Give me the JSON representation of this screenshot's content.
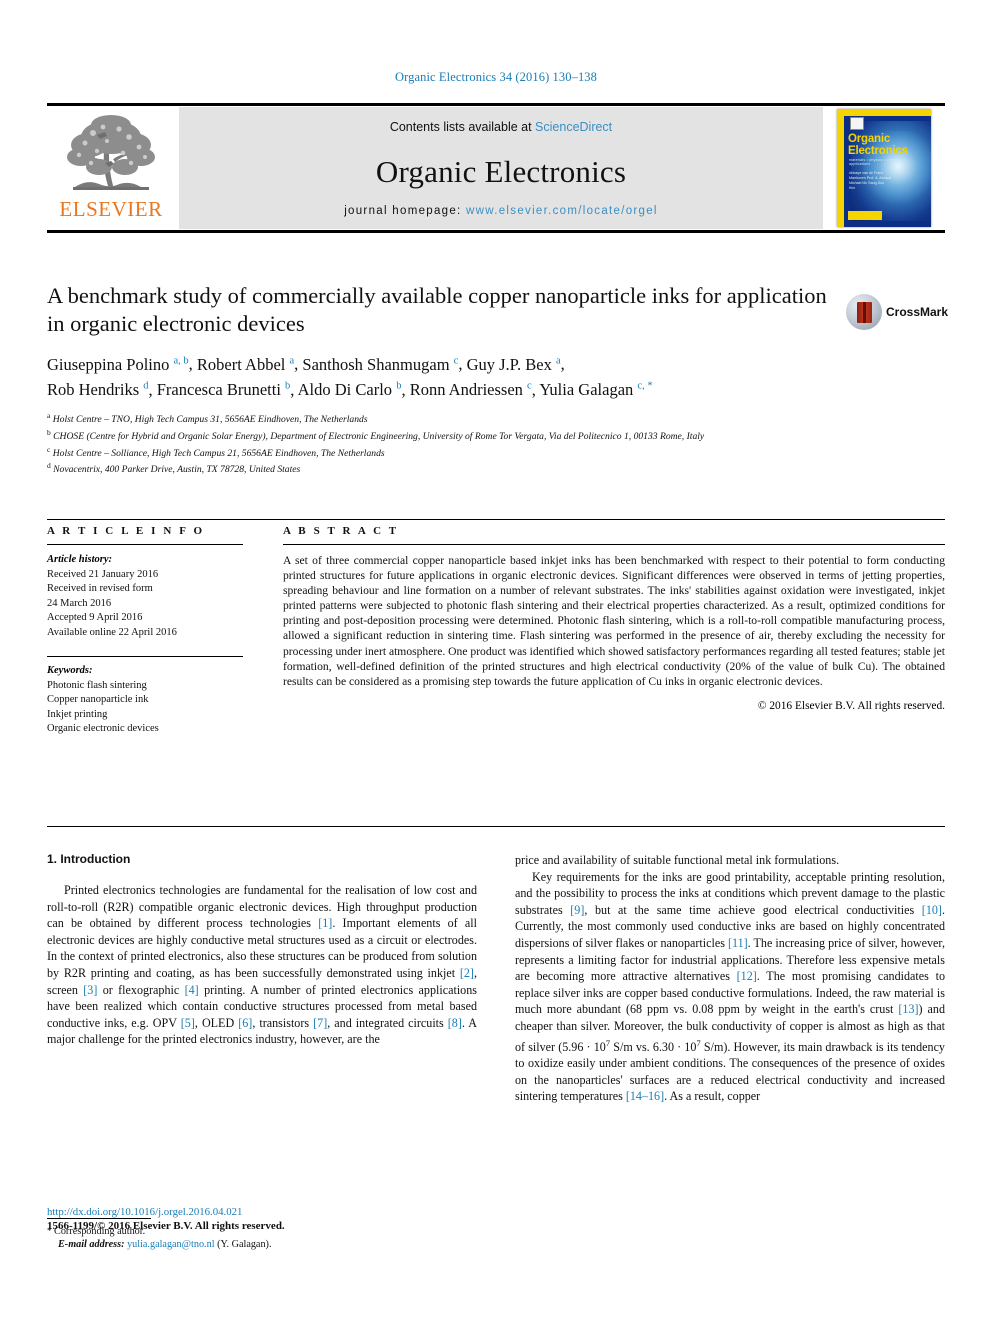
{
  "running_head": "Organic Electronics 34 (2016) 130–138",
  "masthead": {
    "publisher_logo_text": "ELSEVIER",
    "contents_prefix": "Contents lists available at ",
    "contents_link": "ScienceDirect",
    "journal_name": "Organic Electronics",
    "homepage_prefix": "journal homepage: ",
    "homepage_url": "www.elsevier.com/locate/orgel",
    "cover": {
      "title_line1": "Organic",
      "title_line2": "Electronics",
      "subtitle": "materials • physics • chemistry • applications",
      "editors_label": "Editors:",
      "editors": "Abbaye van de\nFrans Manhoven\nProf. A. Arnaud\nMichael Mc\nSang-Soo Kim",
      "publisher_mark": "ELSEVIER"
    }
  },
  "article": {
    "title": "A benchmark study of commercially available copper nanoparticle inks for application in organic electronic devices",
    "crossmark_label": "CrossMark",
    "authors_line1": "Giuseppina Polino",
    "authors": [
      {
        "name": "Giuseppina Polino",
        "sup": "a, b"
      },
      {
        "name": "Robert Abbel",
        "sup": "a"
      },
      {
        "name": "Santhosh Shanmugam",
        "sup": "c"
      },
      {
        "name": "Guy J.P. Bex",
        "sup": "a"
      },
      {
        "name": "Rob Hendriks",
        "sup": "d"
      },
      {
        "name": "Francesca Brunetti",
        "sup": "b"
      },
      {
        "name": "Aldo Di Carlo",
        "sup": "b"
      },
      {
        "name": "Ronn Andriessen",
        "sup": "c"
      },
      {
        "name": "Yulia Galagan",
        "sup": "c, *"
      }
    ],
    "affiliations": [
      {
        "mark": "a",
        "text": "Holst Centre – TNO, High Tech Campus 31, 5656AE Eindhoven, The Netherlands"
      },
      {
        "mark": "b",
        "text": "CHOSE (Centre for Hybrid and Organic Solar Energy), Department of Electronic Engineering, University of Rome Tor Vergata, Via del Politecnico 1, 00133 Rome, Italy"
      },
      {
        "mark": "c",
        "text": "Holst Centre – Solliance, High Tech Campus 21, 5656AE Eindhoven, The Netherlands"
      },
      {
        "mark": "d",
        "text": "Novacentrix, 400 Parker Drive, Austin, TX 78728, United States"
      }
    ]
  },
  "article_info": {
    "heading": "A R T I C L E  I N F O",
    "history_label": "Article history:",
    "history": [
      "Received 21 January 2016",
      "Received in revised form",
      "24 March 2016",
      "Accepted 9 April 2016",
      "Available online 22 April 2016"
    ],
    "keywords_label": "Keywords:",
    "keywords": [
      "Photonic flash sintering",
      "Copper nanoparticle ink",
      "Inkjet printing",
      "Organic electronic devices"
    ]
  },
  "abstract": {
    "heading": "A B S T R A C T",
    "text": "A set of three commercial copper nanoparticle based inkjet inks has been benchmarked with respect to their potential to form conducting printed structures for future applications in organic electronic devices. Significant differences were observed in terms of jetting properties, spreading behaviour and line formation on a number of relevant substrates. The inks' stabilities against oxidation were investigated, inkjet printed patterns were subjected to photonic flash sintering and their electrical properties characterized. As a result, optimized conditions for printing and post-deposition processing were determined. Photonic flash sintering, which is a roll-to-roll compatible manufacturing process, allowed a significant reduction in sintering time. Flash sintering was performed in the presence of air, thereby excluding the necessity for processing under inert atmosphere. One product was identified which showed satisfactory performances regarding all tested features; stable jet formation, well-defined definition of the printed structures and high electrical conductivity (20% of the value of bulk Cu). The obtained results can be considered as a promising step towards the future application of Cu inks in organic electronic devices.",
    "copyright": "© 2016 Elsevier B.V. All rights reserved."
  },
  "body": {
    "section_heading": "1. Introduction",
    "left_para_1": "Printed electronics technologies are fundamental for the realisation of low cost and roll-to-roll (R2R) compatible organic electronic devices. High throughput production can be obtained by different process technologies [1]. Important elements of all electronic devices are highly conductive metal structures used as a circuit or electrodes. In the context of printed electronics, also these structures can be produced from solution by R2R printing and coating, as has been successfully demonstrated using inkjet [2], screen [3] or flexographic [4] printing. A number of printed electronics applications have been realized which contain conductive structures processed from metal based conductive inks, e.g. OPV [5], OLED [6], transistors [7], and integrated circuits [8]. A major challenge for the printed electronics industry, however, are the",
    "right_para_1": "price and availability of suitable functional metal ink formulations.",
    "right_para_2": "Key requirements for the inks are good printability, acceptable printing resolution, and the possibility to process the inks at conditions which prevent damage to the plastic substrates [9], but at the same time achieve good electrical conductivities [10]. Currently, the most commonly used conductive inks are based on highly concentrated dispersions of silver flakes or nanoparticles [11]. The increasing price of silver, however, represents a limiting factor for industrial applications. Therefore less expensive metals are becoming more attractive alternatives [12]. The most promising candidates to replace silver inks are copper based conductive formulations. Indeed, the raw material is much more abundant (68 ppm vs. 0.08 ppm by weight in the earth's crust [13]) and cheaper than silver. Moreover, the bulk conductivity of copper is almost as high as that of silver (5.96 · 10⁷ S/m vs. 6.30 · 10⁷ S/m). However, its main drawback is its tendency to oxidize easily under ambient conditions. The consequences of the presence of oxides on the nanoparticles' surfaces are a reduced electrical conductivity and increased sintering temperatures [14–16]. As a result, copper"
  },
  "footnote": {
    "star": "*",
    "corresponding": "Corresponding author.",
    "email_label": "E-mail address:",
    "email": "yulia.galagan@tno.nl",
    "email_suffix": "(Y. Galagan)."
  },
  "footer": {
    "doi": "http://dx.doi.org/10.1016/j.orgel.2016.04.021",
    "issn": "1566-1199/© 2016 Elsevier B.V. All rights reserved."
  },
  "colors": {
    "link_blue": "#1a7db6",
    "elsevier_orange": "#E87722",
    "masthead_grey": "#e3e3e3"
  }
}
